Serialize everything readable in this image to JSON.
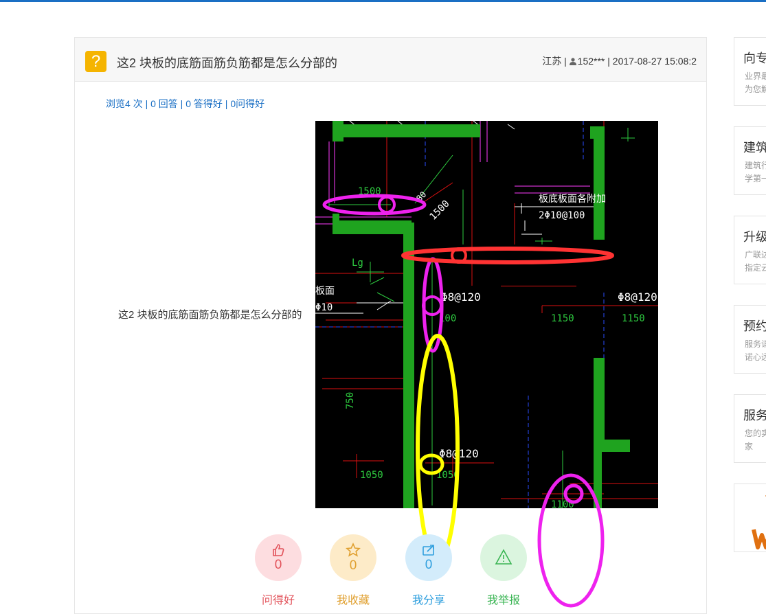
{
  "question": {
    "title": "这2 块板的底筋面筋负筋都是怎么分部的",
    "meta_location": "江苏 |",
    "meta_user": "152***",
    "meta_time": "| 2017-08-27 15:08:2",
    "stats": {
      "views": "浏览4 次",
      "sep1": " | ",
      "answers": "0 回答",
      "sep2": " | ",
      "good_answers": "0 答得好",
      "sep3": " | ",
      "good_questions": "0问得好"
    },
    "body": "这2 块板的底筋面筋负筋都是怎么分部的"
  },
  "drawing": {
    "texts": {
      "t1500a": "1500",
      "t1500b": "1500",
      "t80": "80",
      "note1": "板底板面各附加",
      "note2": "2Φ10@100",
      "lg": "Lg",
      "mian": "板面",
      "phi10": "Φ10",
      "p8a": "Φ8@120",
      "p8b": "Φ8@120",
      "p8c": "Φ8@120",
      "n100": "100",
      "n1150a": "1150",
      "n1150b": "1150",
      "n750": "750",
      "n1050a": "1050",
      "n1050b": "1050",
      "n1100": "1100"
    }
  },
  "actions": [
    {
      "count": "0",
      "label": "问得好",
      "color": "#e2535b",
      "bg": "#fddde0",
      "icon": "thumbs-up"
    },
    {
      "count": "0",
      "label": "我收藏",
      "color": "#e0a030",
      "bg": "#fdebc8",
      "icon": "star"
    },
    {
      "count": "0",
      "label": "我分享",
      "color": "#2f9fde",
      "bg": "#d3ecfb",
      "icon": "share"
    },
    {
      "count": "",
      "label": "我举报",
      "color": "#3bb554",
      "bg": "#dbf5df",
      "icon": "warning"
    }
  ],
  "sidebar": [
    {
      "title": "向专",
      "desc1": "业界最",
      "desc2": "为您解"
    },
    {
      "title": "建筑",
      "desc1": "建筑行",
      "desc2": "学第一"
    },
    {
      "title": "升级",
      "desc1": "广联达",
      "desc2": "指定云"
    },
    {
      "title": "预约",
      "desc1": "服务请",
      "desc2": "诺心远"
    },
    {
      "title": "服务",
      "desc1": "您的实",
      "desc2": "家"
    },
    {
      "title": "",
      "desc1": "",
      "desc2": ""
    }
  ],
  "colors": {
    "accent": "#1a6fc4",
    "icon_bg": "#f5b400"
  }
}
